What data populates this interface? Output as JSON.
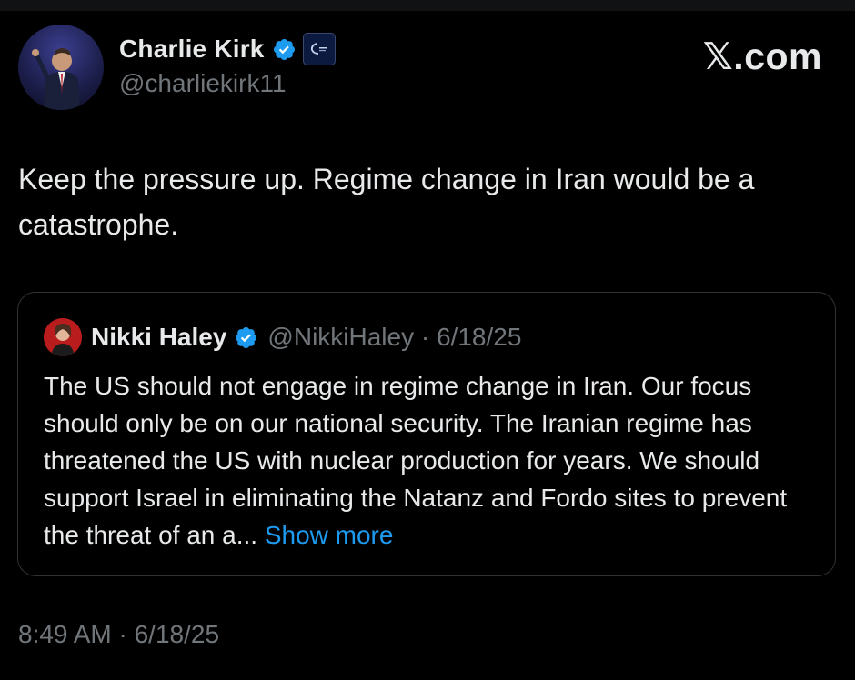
{
  "author": {
    "display_name": "Charlie Kirk",
    "handle": "@charliekirk11",
    "verified_icon": "verified-badge-icon",
    "affiliation_icon": "affiliate-org-icon"
  },
  "brand": {
    "label": "𝕏.com"
  },
  "tweet": {
    "text": "Keep the pressure up. Regime change in Iran would be a catastrophe.",
    "timestamp": "8:49 AM · 6/18/25"
  },
  "quote": {
    "display_name": "Nikki Haley",
    "handle": "@NikkiHaley",
    "date": "6/18/25",
    "meta": "@NikkiHaley · 6/18/25",
    "text": "The US should not engage in regime change in Iran. Our focus should only be on our national security. The Iranian regime has threatened the US with nuclear production for years. We should support Israel in eliminating the Natanz and Fordo sites to prevent the threat of an a...",
    "show_more": "Show more"
  },
  "colors": {
    "background": "#000000",
    "text": "#e7e9ea",
    "secondary": "#71767b",
    "accent": "#1d9bf0",
    "border": "#2f3336"
  }
}
